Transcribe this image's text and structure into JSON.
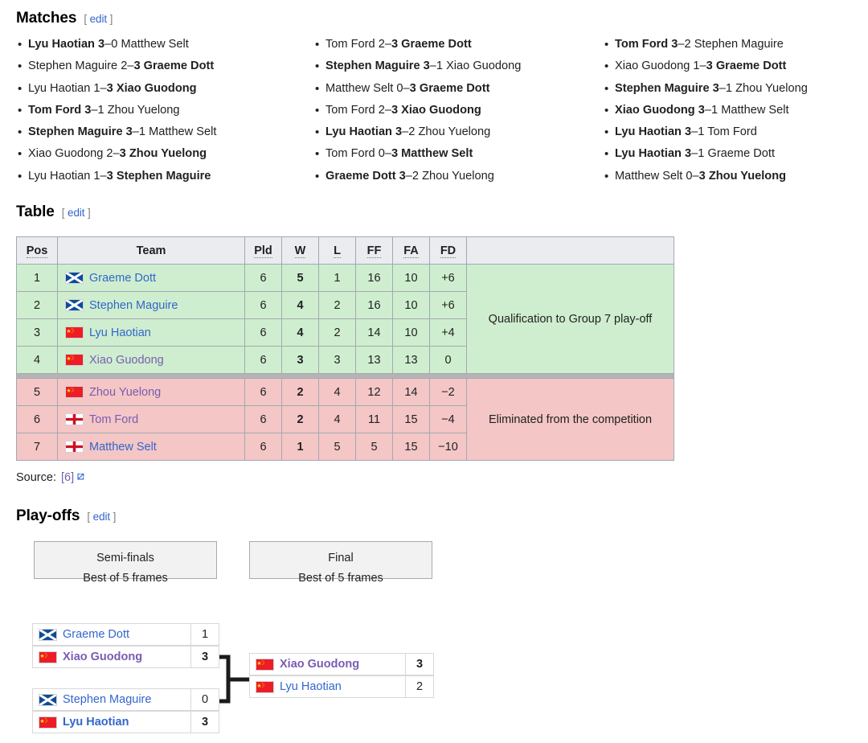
{
  "sections": {
    "matches": {
      "title": "Matches",
      "edit": "edit",
      "bracket_open": "[",
      "bracket_close": "]"
    },
    "table": {
      "title": "Table",
      "edit": "edit"
    },
    "playoffs": {
      "title": "Play-offs",
      "edit": "edit"
    }
  },
  "matches": {
    "col1": [
      {
        "left": "Lyu Haotian",
        "left_bold": true,
        "score": "3–0",
        "right": "Matthew Selt",
        "right_bold": false
      },
      {
        "left": "Stephen Maguire",
        "left_bold": false,
        "score": "2–3",
        "right": "Graeme Dott",
        "right_bold": true
      },
      {
        "left": "Lyu Haotian",
        "left_bold": false,
        "score": "1–3",
        "right": "Xiao Guodong",
        "right_bold": true
      },
      {
        "left": "Tom Ford",
        "left_bold": true,
        "score": "3–1",
        "right": "Zhou Yuelong",
        "right_bold": false
      },
      {
        "left": "Stephen Maguire",
        "left_bold": true,
        "score": "3–1",
        "right": "Matthew Selt",
        "right_bold": false
      },
      {
        "left": "Xiao Guodong",
        "left_bold": false,
        "score": "2–3",
        "right": "Zhou Yuelong",
        "right_bold": true
      },
      {
        "left": "Lyu Haotian",
        "left_bold": false,
        "score": "1–3",
        "right": "Stephen Maguire",
        "right_bold": true
      }
    ],
    "col2": [
      {
        "left": "Tom Ford",
        "left_bold": false,
        "score": "2–3",
        "right": "Graeme Dott",
        "right_bold": true
      },
      {
        "left": "Stephen Maguire",
        "left_bold": true,
        "score": "3–1",
        "right": "Xiao Guodong",
        "right_bold": false
      },
      {
        "left": "Matthew Selt",
        "left_bold": false,
        "score": "0–3",
        "right": "Graeme Dott",
        "right_bold": true
      },
      {
        "left": "Tom Ford",
        "left_bold": false,
        "score": "2–3",
        "right": "Xiao Guodong",
        "right_bold": true
      },
      {
        "left": "Lyu Haotian",
        "left_bold": true,
        "score": "3–2",
        "right": "Zhou Yuelong",
        "right_bold": false
      },
      {
        "left": "Tom Ford",
        "left_bold": false,
        "score": "0–3",
        "right": "Matthew Selt",
        "right_bold": true
      },
      {
        "left": "Graeme Dott",
        "left_bold": true,
        "score": "3–2",
        "right": "Zhou Yuelong",
        "right_bold": false
      }
    ],
    "col3": [
      {
        "left": "Tom Ford",
        "left_bold": true,
        "score": "3–2",
        "right": "Stephen Maguire",
        "right_bold": false
      },
      {
        "left": "Xiao Guodong",
        "left_bold": false,
        "score": "1–3",
        "right": "Graeme Dott",
        "right_bold": true
      },
      {
        "left": "Stephen Maguire",
        "left_bold": true,
        "score": "3–1",
        "right": "Zhou Yuelong",
        "right_bold": false
      },
      {
        "left": "Xiao Guodong",
        "left_bold": true,
        "score": "3–1",
        "right": "Matthew Selt",
        "right_bold": false
      },
      {
        "left": "Lyu Haotian",
        "left_bold": true,
        "score": "3–1",
        "right": "Tom Ford",
        "right_bold": false
      },
      {
        "left": "Lyu Haotian",
        "left_bold": true,
        "score": "3–1",
        "right": "Graeme Dott",
        "right_bold": false
      },
      {
        "left": "Matthew Selt",
        "left_bold": false,
        "score": "0–3",
        "right": "Zhou Yuelong",
        "right_bold": true
      }
    ]
  },
  "table": {
    "headers": [
      "Pos",
      "Team",
      "Pld",
      "W",
      "L",
      "FF",
      "FA",
      "FD",
      ""
    ],
    "rows": [
      {
        "pos": "1",
        "team": "Graeme Dott",
        "flag": "scotland",
        "visited": false,
        "pld": "6",
        "w": "5",
        "l": "1",
        "ff": "16",
        "fa": "10",
        "fd": "+6",
        "zone": "q"
      },
      {
        "pos": "2",
        "team": "Stephen Maguire",
        "flag": "scotland",
        "visited": false,
        "pld": "6",
        "w": "4",
        "l": "2",
        "ff": "16",
        "fa": "10",
        "fd": "+6",
        "zone": "q"
      },
      {
        "pos": "3",
        "team": "Lyu Haotian",
        "flag": "china",
        "visited": false,
        "pld": "6",
        "w": "4",
        "l": "2",
        "ff": "14",
        "fa": "10",
        "fd": "+4",
        "zone": "q"
      },
      {
        "pos": "4",
        "team": "Xiao Guodong",
        "flag": "china",
        "visited": true,
        "pld": "6",
        "w": "3",
        "l": "3",
        "ff": "13",
        "fa": "13",
        "fd": "0",
        "zone": "q"
      },
      {
        "pos": "5",
        "team": "Zhou Yuelong",
        "flag": "china",
        "visited": true,
        "pld": "6",
        "w": "2",
        "l": "4",
        "ff": "12",
        "fa": "14",
        "fd": "−2",
        "zone": "e"
      },
      {
        "pos": "6",
        "team": "Tom Ford",
        "flag": "england",
        "visited": true,
        "pld": "6",
        "w": "2",
        "l": "4",
        "ff": "11",
        "fa": "15",
        "fd": "−4",
        "zone": "e"
      },
      {
        "pos": "7",
        "team": "Matthew Selt",
        "flag": "england",
        "visited": false,
        "pld": "6",
        "w": "1",
        "l": "5",
        "ff": "5",
        "fa": "15",
        "fd": "−10",
        "zone": "e"
      }
    ],
    "qualification_note": "Qualification to Group 7 play-off",
    "elimination_note": "Eliminated from the competition"
  },
  "source": {
    "label": "Source:",
    "ref": "[6]"
  },
  "playoffs": {
    "rounds": [
      {
        "name": "Semi-finals",
        "format": "Best of 5 frames"
      },
      {
        "name": "Final",
        "format": "Best of 5 frames"
      }
    ],
    "semifinal1": [
      {
        "name": "Graeme Dott",
        "flag": "scotland",
        "visited": false,
        "score": "1",
        "winner": false
      },
      {
        "name": "Xiao Guodong",
        "flag": "china",
        "visited": true,
        "score": "3",
        "winner": true
      }
    ],
    "semifinal2": [
      {
        "name": "Stephen Maguire",
        "flag": "scotland",
        "visited": false,
        "score": "0",
        "winner": false
      },
      {
        "name": "Lyu Haotian",
        "flag": "china",
        "visited": false,
        "score": "3",
        "winner": true
      }
    ],
    "final": [
      {
        "name": "Xiao Guodong",
        "flag": "china",
        "visited": true,
        "score": "3",
        "winner": true
      },
      {
        "name": "Lyu Haotian",
        "flag": "china",
        "visited": false,
        "score": "2",
        "winner": false
      }
    ]
  },
  "colors": {
    "link": "#3366cc",
    "visited_link": "#795cb2",
    "qualify_green": "#cfeecf",
    "eliminated_red": "#f4c6c6",
    "header_gray": "#eaecf0",
    "border_gray": "#a2a9b1"
  }
}
